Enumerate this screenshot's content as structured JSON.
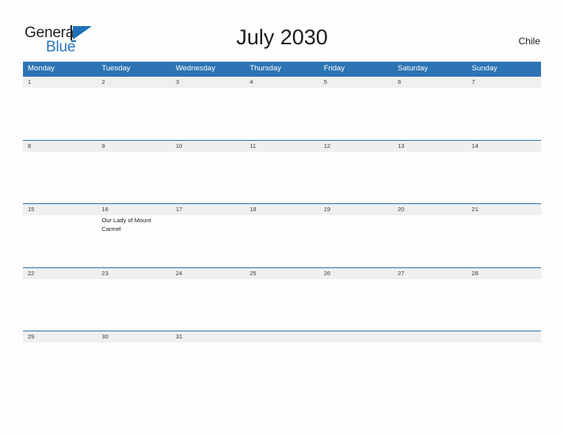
{
  "brand": {
    "name_part1": "General",
    "name_part2": "Blue",
    "logo_icon": "flag-triangle-icon",
    "primary_color": "#2878be"
  },
  "header": {
    "title": "July 2030",
    "country": "Chile"
  },
  "theme": {
    "header_blue": "#2c74b3",
    "date_strip_grey": "#efefef",
    "page_background": "#fdfdfd",
    "text_color": "#1c1c1c"
  },
  "calendar": {
    "month": "July",
    "year": "2030",
    "weekday_headers": [
      "Monday",
      "Tuesday",
      "Wednesday",
      "Thursday",
      "Friday",
      "Saturday",
      "Sunday"
    ],
    "weeks": [
      {
        "dates": [
          "1",
          "2",
          "3",
          "4",
          "5",
          "6",
          "7"
        ],
        "events": [
          "",
          "",
          "",
          "",
          "",
          "",
          ""
        ]
      },
      {
        "dates": [
          "8",
          "9",
          "10",
          "11",
          "12",
          "13",
          "14"
        ],
        "events": [
          "",
          "",
          "",
          "",
          "",
          "",
          ""
        ]
      },
      {
        "dates": [
          "15",
          "16",
          "17",
          "18",
          "19",
          "20",
          "21"
        ],
        "events": [
          "",
          "Our Lady of Mount Carmel",
          "",
          "",
          "",
          "",
          ""
        ]
      },
      {
        "dates": [
          "22",
          "23",
          "24",
          "25",
          "26",
          "27",
          "28"
        ],
        "events": [
          "",
          "",
          "",
          "",
          "",
          "",
          ""
        ]
      },
      {
        "dates": [
          "29",
          "30",
          "31",
          "",
          "",
          "",
          ""
        ],
        "events": [
          "",
          "",
          "",
          "",
          "",
          "",
          ""
        ]
      }
    ]
  }
}
